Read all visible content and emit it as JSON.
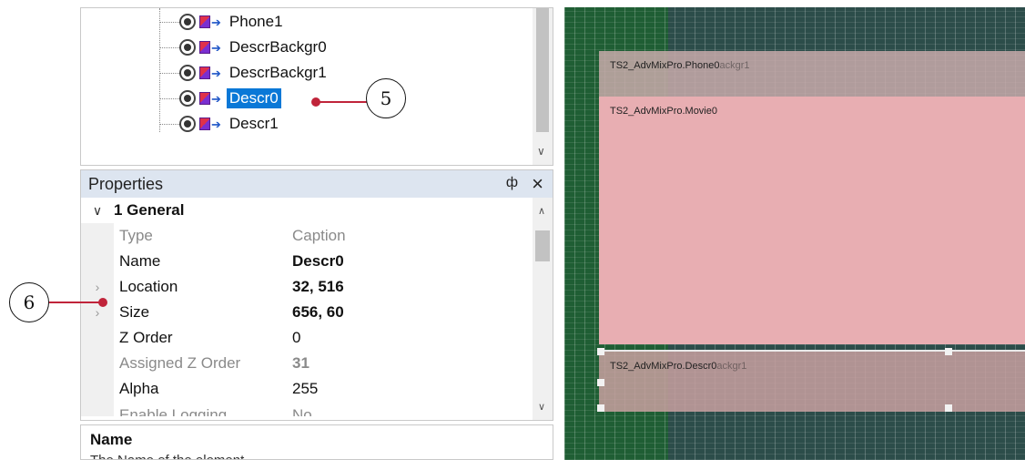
{
  "tree": {
    "items": [
      {
        "label": "Phone1",
        "selected": false
      },
      {
        "label": "DescrBackgr0",
        "selected": false
      },
      {
        "label": "DescrBackgr1",
        "selected": false
      },
      {
        "label": "Descr0",
        "selected": true
      },
      {
        "label": "Descr1",
        "selected": false
      }
    ]
  },
  "properties": {
    "title": "Properties",
    "pin_icon": "pin-icon",
    "close_icon": "close-icon",
    "group": "1 General",
    "rows": [
      {
        "name": "Type",
        "value": "Caption"
      },
      {
        "name": "Name",
        "value": "Descr0"
      },
      {
        "name": "Location",
        "value": "32, 516"
      },
      {
        "name": "Size",
        "value": "656, 60"
      },
      {
        "name": "Z Order",
        "value": "0"
      },
      {
        "name": "Assigned Z Order",
        "value": "31"
      },
      {
        "name": "Alpha",
        "value": "255"
      },
      {
        "name": "Enable Logging",
        "value": "No"
      }
    ],
    "description_title": "Name",
    "description_text": "The Name of the element."
  },
  "callouts": {
    "five": "5",
    "six": "6"
  },
  "canvas": {
    "layer_phone": "TS2_AdvMixPro.Phone0",
    "layer_phone_ghost": "ackgr1",
    "layer_movie": "TS2_AdvMixPro.Movie0",
    "layer_descr": "TS2_AdvMixPro.Descr0",
    "layer_descr_ghost": "ackgr1"
  },
  "colors": {
    "selection": "#0a78d7",
    "callout": "#c0243a",
    "canvas_bg": "#2c4d4a",
    "movie_layer": "#e8aeb2"
  }
}
